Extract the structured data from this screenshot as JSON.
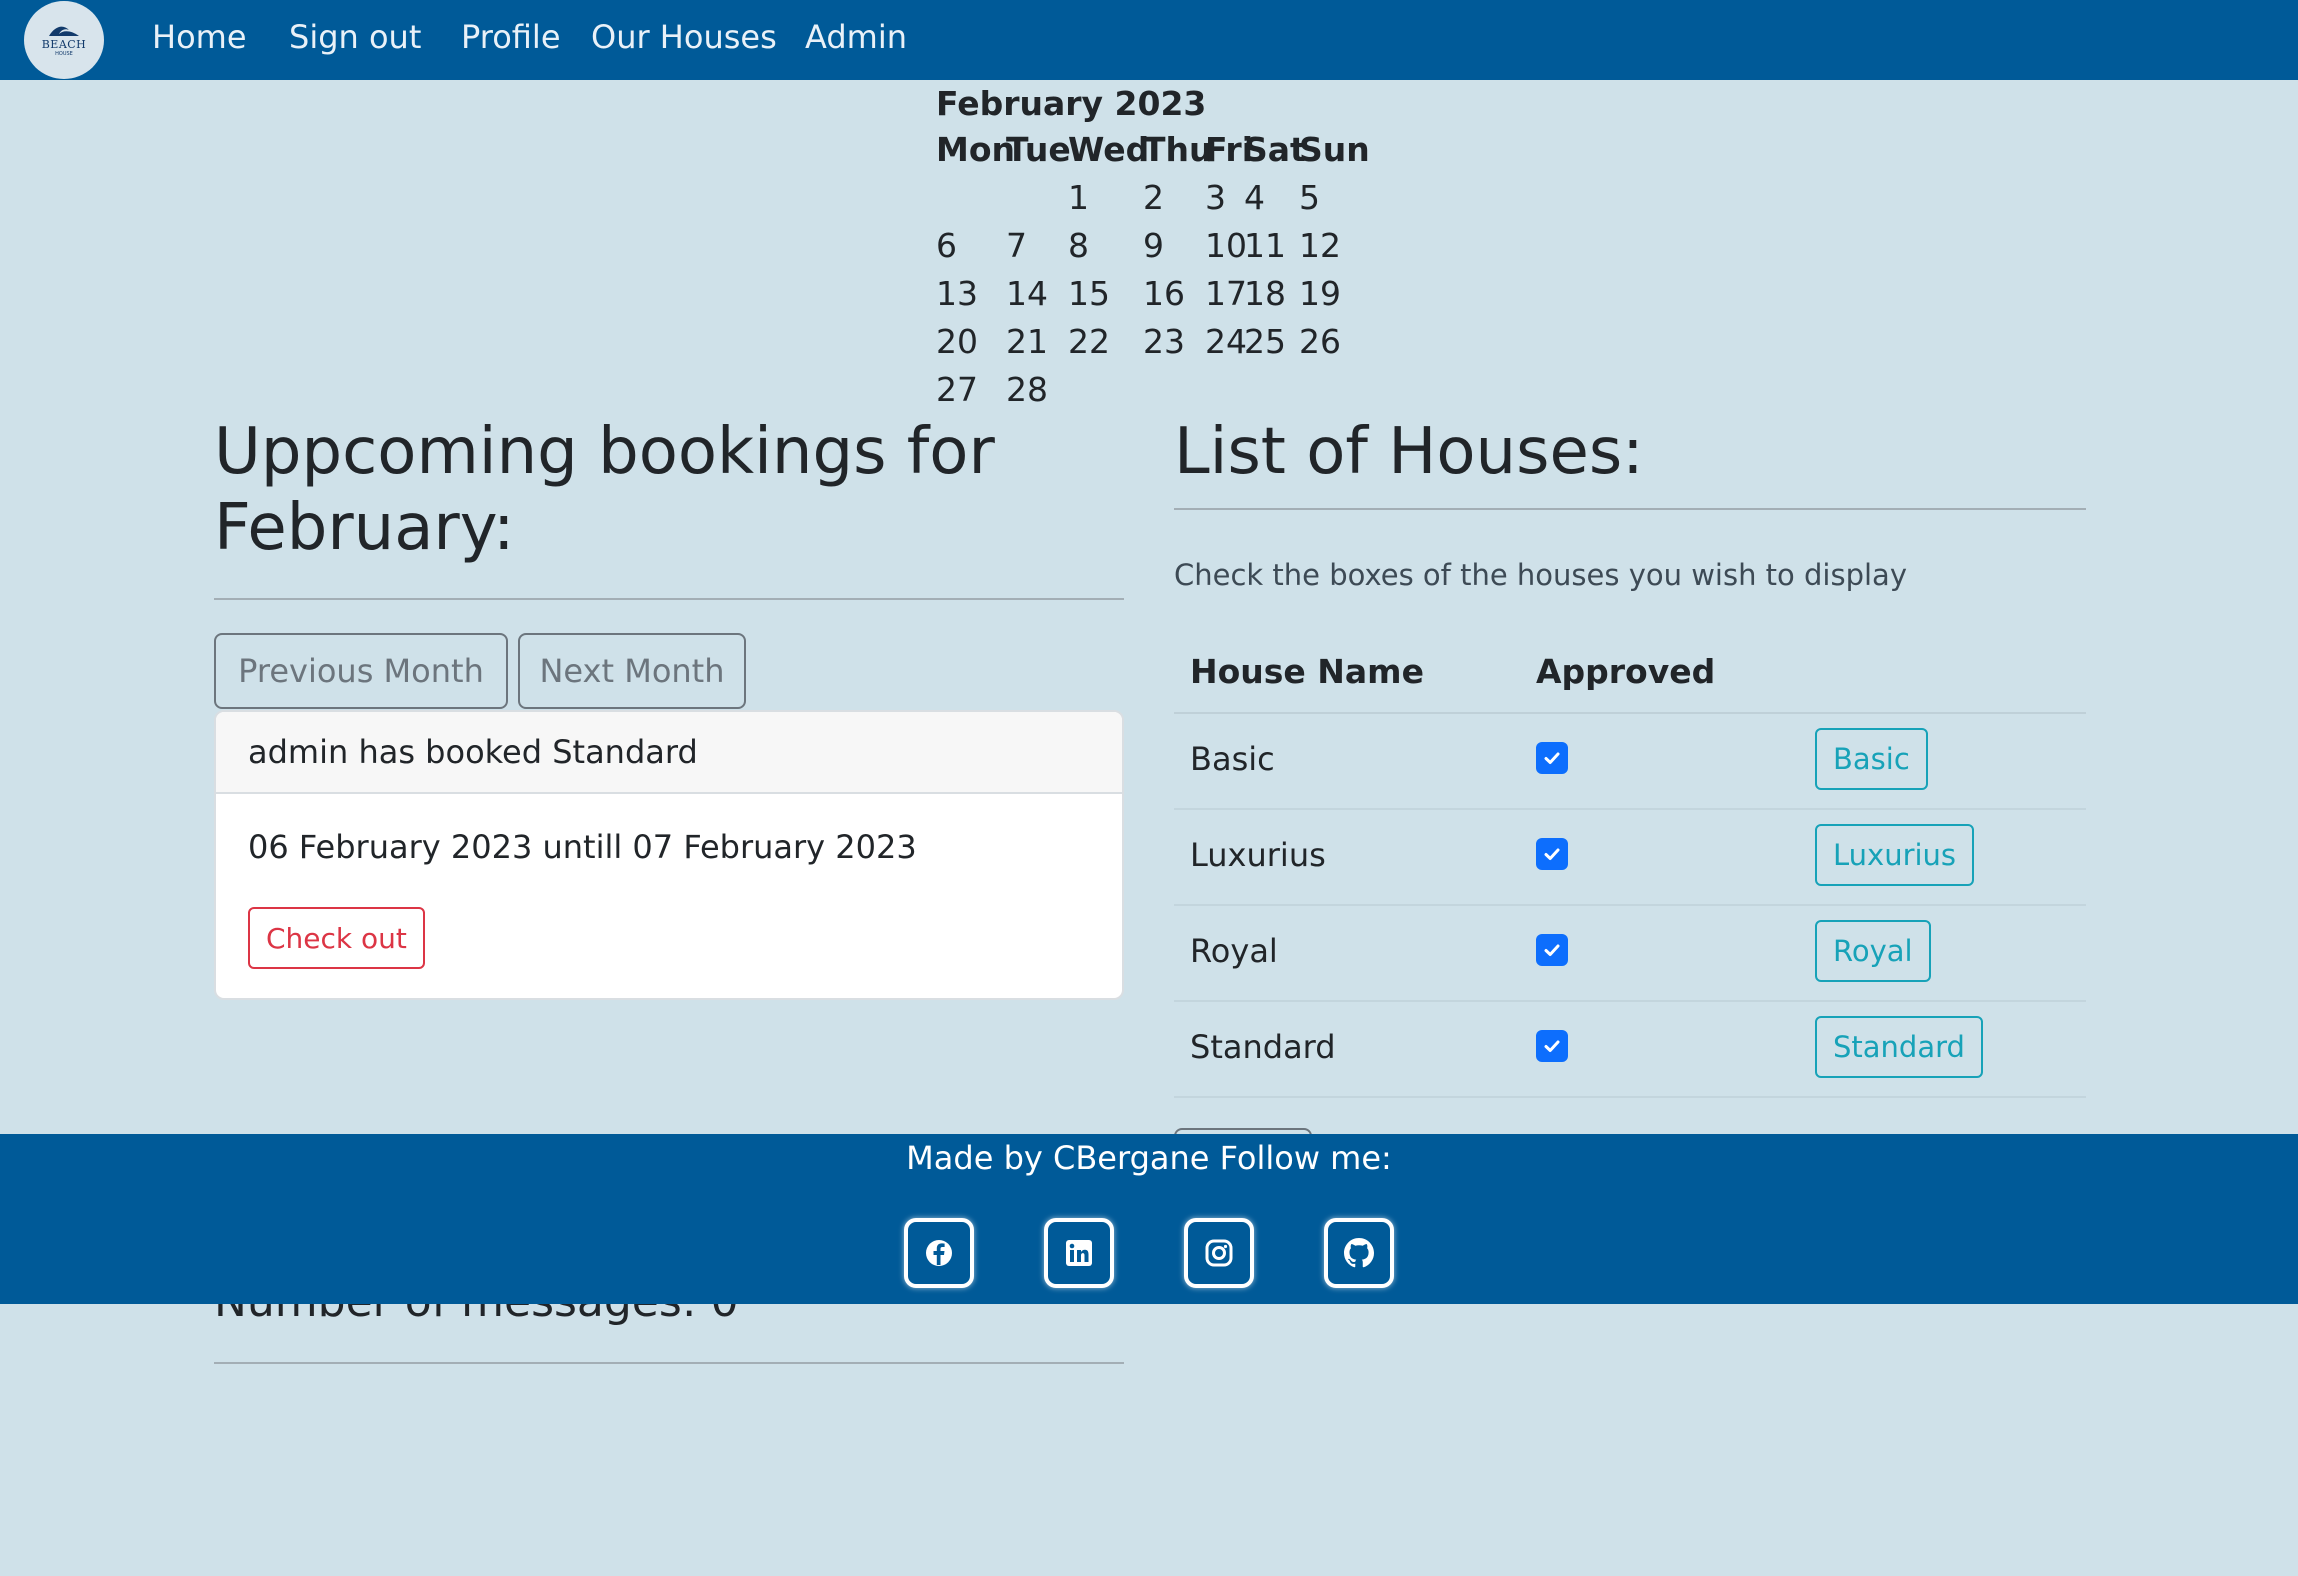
{
  "nav": {
    "logo_text": "BEACH",
    "logo_sub": "HOUSE",
    "links": [
      "Home",
      "Sign out",
      "Profile",
      "Our Houses",
      "Admin"
    ]
  },
  "calendar": {
    "title": "February 2023",
    "weekdays": [
      "Mon",
      "Tue",
      "Wed",
      "Thu",
      "Fri",
      "Sat",
      "Sun"
    ],
    "weeks": [
      [
        "",
        "",
        "1",
        "2",
        "3",
        "4",
        "5"
      ],
      [
        "6",
        "7",
        "8",
        "9",
        "10",
        "11",
        "12"
      ],
      [
        "13",
        "14",
        "15",
        "16",
        "17",
        "18",
        "19"
      ],
      [
        "20",
        "21",
        "22",
        "23",
        "24",
        "25",
        "26"
      ],
      [
        "27",
        "28",
        "",
        "",
        "",
        "",
        ""
      ]
    ]
  },
  "bookings": {
    "title_line1": "Uppcoming bookings for",
    "title_line2": "February:",
    "prev_label": "Previous Month",
    "next_label": "Next Month",
    "card_header": "admin has booked Standard",
    "card_dates": "06 February 2023 untill 07 February 2023",
    "checkout_label": "Check out"
  },
  "houses": {
    "title": "List of Houses:",
    "instructions": "Check the boxes of the houses you wish to display",
    "col_name": "House Name",
    "col_approved": "Approved",
    "rows": [
      {
        "name": "Basic",
        "approved": true,
        "button": "Basic"
      },
      {
        "name": "Luxurius",
        "approved": true,
        "button": "Luxurius"
      },
      {
        "name": "Royal",
        "approved": true,
        "button": "Royal"
      },
      {
        "name": "Standard",
        "approved": true,
        "button": "Standard"
      }
    ]
  },
  "messages": {
    "text": "Number of messages: 0"
  },
  "footer": {
    "text": "Made by CBergane Follow me:",
    "icons": [
      "facebook-icon",
      "linkedin-icon",
      "instagram-icon",
      "github-icon"
    ]
  },
  "colors": {
    "nav_bg": "#005a98",
    "page_bg": "#cfe1e9",
    "danger": "#dc3545",
    "info": "#17a2b8",
    "checkbox": "#0d6efd"
  }
}
